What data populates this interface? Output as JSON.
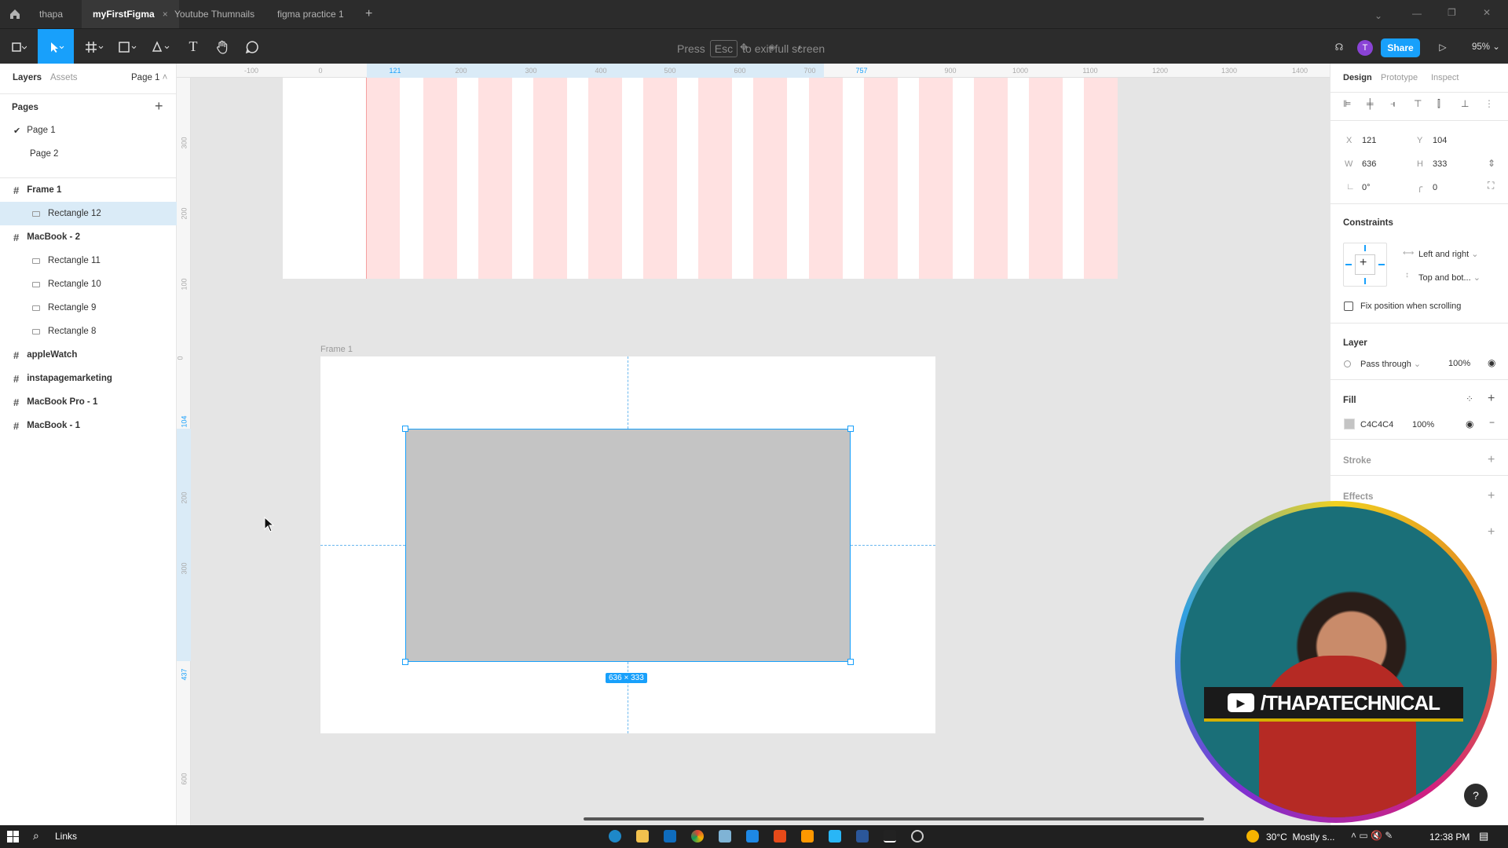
{
  "tabs": {
    "home_icon": "home-icon",
    "items": [
      {
        "label": "thapa"
      },
      {
        "label": "myFirstFigma",
        "active": true
      },
      {
        "label": "Youtube Thumnails"
      },
      {
        "label": "figma practice 1"
      }
    ],
    "add": "+",
    "close": "×"
  },
  "toolbar": {
    "fullscreen_press": "Press",
    "fullscreen_key": "Esc",
    "fullscreen_rest": "to exit full screen",
    "avatar": "T",
    "share": "Share",
    "zoom": "95%"
  },
  "left_panel": {
    "tab_layers": "Layers",
    "tab_assets": "Assets",
    "page_selector": "Page 1",
    "pages_title": "Pages",
    "pages": [
      {
        "label": "Page 1",
        "current": true
      },
      {
        "label": "Page 2"
      }
    ],
    "layers": [
      {
        "label": "Frame 1",
        "kind": "frame",
        "indent": 0
      },
      {
        "label": "Rectangle 12",
        "kind": "rect",
        "indent": 1,
        "selected": true
      },
      {
        "label": "MacBook - 2",
        "kind": "frame",
        "indent": 0
      },
      {
        "label": "Rectangle 11",
        "kind": "rect",
        "indent": 1
      },
      {
        "label": "Rectangle 10",
        "kind": "rect",
        "indent": 1
      },
      {
        "label": "Rectangle 9",
        "kind": "rect",
        "indent": 1
      },
      {
        "label": "Rectangle 8",
        "kind": "rect",
        "indent": 1
      },
      {
        "label": "appleWatch",
        "kind": "frame",
        "indent": 0
      },
      {
        "label": "instapagemarketing",
        "kind": "frame",
        "indent": 0
      },
      {
        "label": "MacBook Pro - 1",
        "kind": "frame",
        "indent": 0
      },
      {
        "label": "MacBook - 1",
        "kind": "frame",
        "indent": 0
      }
    ]
  },
  "ruler": {
    "top": [
      "-100",
      "0",
      "121",
      "200",
      "300",
      "400",
      "500",
      "600",
      "700",
      "757",
      "900",
      "1000",
      "1100",
      "1200",
      "1300",
      "1400"
    ],
    "left": [
      "300",
      "200",
      "100",
      "0",
      "104",
      "200",
      "300",
      "437",
      "600"
    ]
  },
  "canvas": {
    "frame_label": "Frame 1",
    "selection_size": "636 × 333",
    "rect_fill": "#C4C4C4",
    "stripe_color": "#ffe1e1"
  },
  "right_panel": {
    "tabs": [
      "Design",
      "Prototype",
      "Inspect"
    ],
    "x_label": "X",
    "x": "121",
    "y_label": "Y",
    "y": "104",
    "w_label": "W",
    "w": "636",
    "h_label": "H",
    "h": "333",
    "rotation": "0°",
    "radius": "0",
    "constraints_title": "Constraints",
    "constraint_h": "Left and right",
    "constraint_v": "Top and bot...",
    "fix_position": "Fix position when scrolling",
    "layer_title": "Layer",
    "blend": "Pass through",
    "opacity": "100%",
    "fill_title": "Fill",
    "fill_hex": "C4C4C4",
    "fill_opacity": "100%",
    "stroke_title": "Stroke",
    "effects_title": "Effects"
  },
  "webcam": {
    "channel": "/THAPATECHNICAL"
  },
  "taskbar": {
    "search_label": "Links",
    "weather": "30°C  Mostly s...",
    "time": "12:38 PM"
  }
}
